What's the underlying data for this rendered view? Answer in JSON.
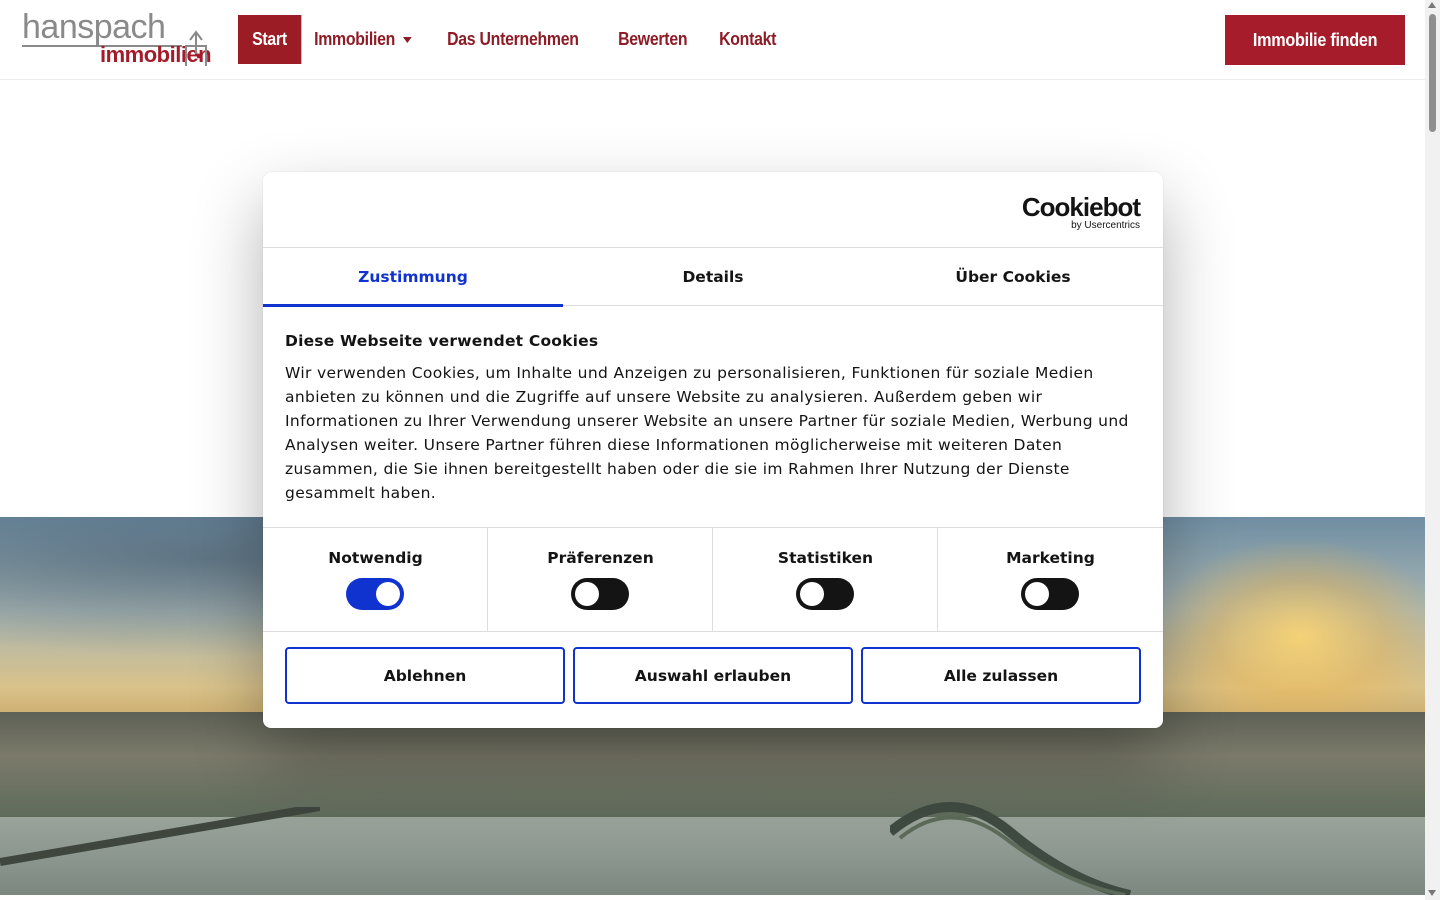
{
  "header": {
    "logo": {
      "top": "hanspach",
      "bottom": "immobilien"
    },
    "nav": [
      {
        "label": "Start",
        "active": true
      },
      {
        "label": "Immobilien",
        "dropdown": true
      },
      {
        "label": "Das Unternehmen"
      },
      {
        "label": "Bewerten"
      },
      {
        "label": "Kontakt"
      }
    ],
    "cta_label": "Immobilie finden"
  },
  "colors": {
    "brand_red": "#a61c2a",
    "cookie_accent": "#1032cf"
  },
  "cookie_dialog": {
    "provider_logo": "Cookiebot",
    "provider_sub": "by Usercentrics",
    "tabs": [
      {
        "label": "Zustimmung",
        "active": true
      },
      {
        "label": "Details"
      },
      {
        "label": "Über Cookies"
      }
    ],
    "title": "Diese Webseite verwendet Cookies",
    "text": "Wir verwenden Cookies, um Inhalte und Anzeigen zu personalisieren, Funktionen für soziale Medien anbieten zu können und die Zugriffe auf unsere Website zu analysieren. Außerdem geben wir Informationen zu Ihrer Verwendung unserer Website an unsere Partner für soziale Medien, Werbung und Analysen weiter. Unsere Partner führen diese Informationen möglicherweise mit weiteren Daten zusammen, die Sie ihnen bereitgestellt haben oder die sie im Rahmen Ihrer Nutzung der Dienste gesammelt haben.",
    "toggles": [
      {
        "label": "Notwendig",
        "on": true
      },
      {
        "label": "Präferenzen",
        "on": false
      },
      {
        "label": "Statistiken",
        "on": false
      },
      {
        "label": "Marketing",
        "on": false
      }
    ],
    "buttons": {
      "reject": "Ablehnen",
      "allow_selection": "Auswahl erlauben",
      "allow_all": "Alle zulassen"
    }
  }
}
